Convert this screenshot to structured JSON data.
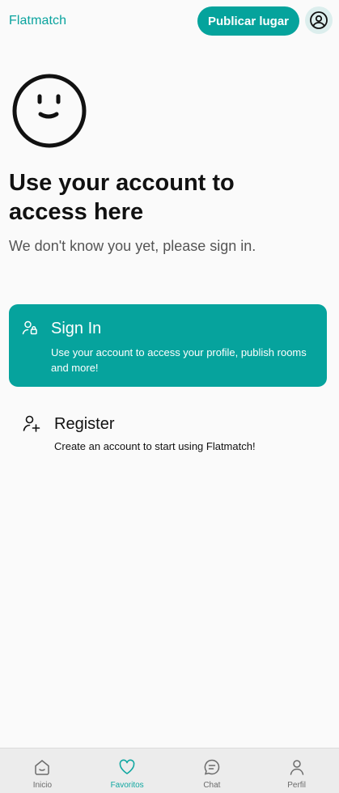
{
  "header": {
    "brand": "Flatmatch",
    "publish_label": "Publicar lugar",
    "account_icon": "user-circle-icon"
  },
  "hero": {
    "icon": "smiley-face-icon",
    "heading": "Use your account to access here",
    "subtitle": "We don't know you yet, please sign in."
  },
  "options": {
    "signin": {
      "icon": "user-lock-icon",
      "title": "Sign In",
      "description": "Use your account to access your profile, publish rooms and more!"
    },
    "register": {
      "icon": "user-plus-icon",
      "title": "Register",
      "description": "Create an account to start using Flatmatch!"
    }
  },
  "bottom_nav": {
    "active": "Favoritos",
    "items": [
      {
        "label": "Inicio",
        "icon": "home-icon"
      },
      {
        "label": "Favoritos",
        "icon": "heart-icon"
      },
      {
        "label": "Chat",
        "icon": "chat-icon"
      },
      {
        "label": "Perfil",
        "icon": "profile-icon"
      }
    ]
  },
  "colors": {
    "accent": "#06a39d",
    "background": "#fafafa",
    "nav_background": "#ececec"
  }
}
